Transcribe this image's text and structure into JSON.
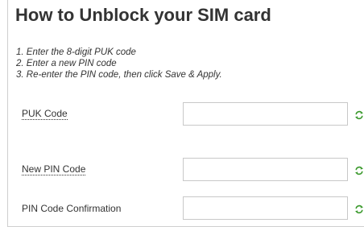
{
  "page": {
    "title": "How to Unblock your SIM card"
  },
  "instructions": [
    "1. Enter the 8-digit PUK code",
    "2. Enter a new PIN code",
    "3. Re-enter the PIN code, then click Save & Apply."
  ],
  "fields": {
    "puk": {
      "label": "PUK Code",
      "value": "",
      "icon": "refresh-icon"
    },
    "new_pin": {
      "label": "New PIN Code",
      "value": "",
      "icon": "refresh-icon"
    },
    "pin_confirm": {
      "label": "PIN Code Confirmation",
      "value": "",
      "icon": "refresh-icon"
    }
  },
  "colors": {
    "text": "#333333",
    "input_border": "#c8c8c8",
    "icon_green": "#3c9a2e"
  }
}
